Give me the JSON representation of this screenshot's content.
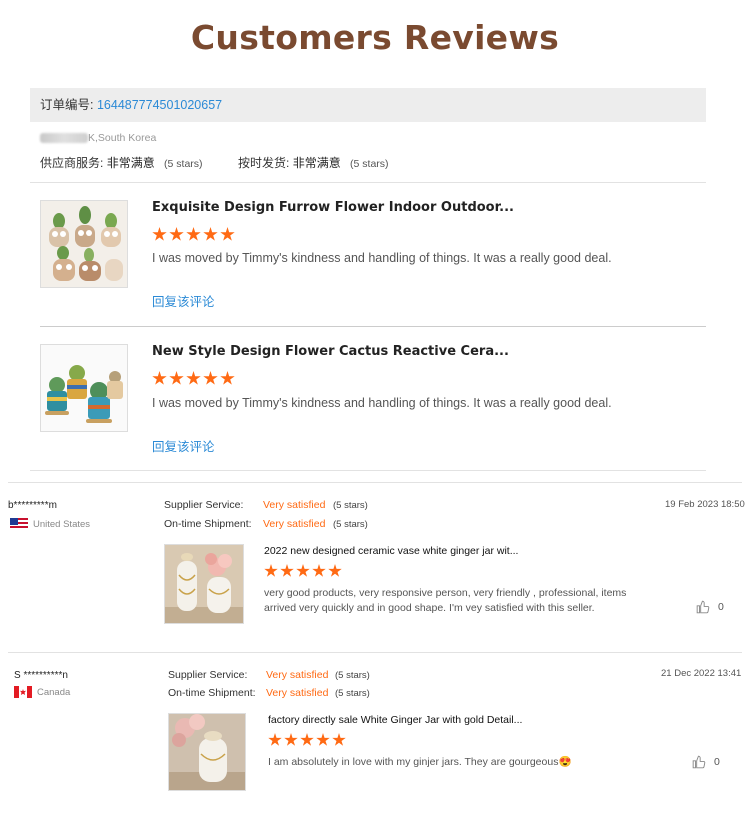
{
  "page_title": "Customers Reviews",
  "order": {
    "label": "订单编号:",
    "number": "164487774501020657",
    "buyer_location": "K,South Korea",
    "supplier_service_label": "供应商服务:",
    "supplier_service_value": "非常满意",
    "supplier_service_stars": "(5 stars)",
    "shipment_label": "按时发货:",
    "shipment_value": "非常满意",
    "shipment_stars": "(5 stars)"
  },
  "order_reviews": [
    {
      "product_title": "Exquisite Design Furrow Flower Indoor Outdoor...",
      "rating": 5,
      "text": "I was moved by Timmy's kindness and handling of things. It was a really good deal.",
      "reply_label": "回复该评论"
    },
    {
      "product_title": "New Style Design Flower Cactus Reactive Cera...",
      "rating": 5,
      "text": "I was moved by Timmy's kindness and handling of things. It was a really good deal.",
      "reply_label": "回复该评论"
    }
  ],
  "reviews": [
    {
      "user": "b*********m",
      "country": "United States",
      "supplier_service_label": "Supplier Service:",
      "supplier_service_value": "Very satisfied",
      "supplier_service_stars": "(5 stars)",
      "shipment_label": "On-time Shipment:",
      "shipment_value": "Very satisfied",
      "shipment_stars": "(5 stars)",
      "date": "19 Feb 2023 18:50",
      "product_title": "2022 new designed ceramic vase white ginger jar wit...",
      "rating": 5,
      "text": "very good products, very responsive person, very friendly , professional, items arrived very quickly and in good shape. I'm vey satisfied with this seller.",
      "likes": "0"
    },
    {
      "user": "S **********n",
      "country": "Canada",
      "supplier_service_label": "Supplier Service:",
      "supplier_service_value": "Very satisfied",
      "supplier_service_stars": "(5 stars)",
      "shipment_label": "On-time Shipment:",
      "shipment_value": "Very satisfied",
      "shipment_stars": "(5 stars)",
      "date": "21 Dec 2022 13:41",
      "product_title": "factory directly sale White Ginger Jar with gold Detail...",
      "rating": 5,
      "text": "I am absolutely in love with my ginjer jars. They are gourgeous😍",
      "likes": "0"
    }
  ],
  "colors": {
    "title": "#7a4a30",
    "link": "#2b8ad6",
    "star": "#ff6a14",
    "satisfied": "#ff6a14"
  },
  "icons": [
    "thumbs-up-icon",
    "star-icon",
    "us-flag-icon",
    "canada-flag-icon"
  ]
}
